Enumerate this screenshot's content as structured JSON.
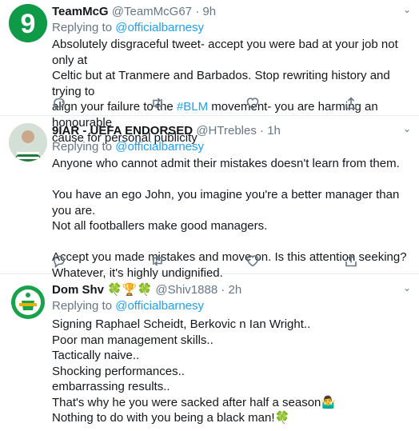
{
  "tweets": [
    {
      "name": "TeamMcG",
      "handle": "@TeamMcG67",
      "dot": "·",
      "time": "9h",
      "reply_prefix": "Replying to",
      "reply_to": "@officialbarnesy",
      "body_lines": [
        "Absolutely disgraceful tweet- accept you were bad at your job not only at",
        "Celtic but at Tranmere and Barbados. Stop rewriting history and trying to"
      ],
      "body_line3_pre": "align your failure to the",
      "hashtag": "#BLM",
      "body_line3_post": "movement- you are harming an honourable",
      "body_line4": "cause for personal publicity",
      "avatar_text": "9"
    },
    {
      "name": "9IAR - UEFA ENDORSED",
      "handle": "@HTrebles",
      "dot": "·",
      "time": "1h",
      "reply_prefix": "Replying to",
      "reply_to": "@officialbarnesy",
      "para1": "Anyone who cannot admit their mistakes doesn't learn from them.",
      "para2a": "You have an ego John, you imagine you're a better manager than you are.",
      "para2b": "Not all footballers make good managers.",
      "para3a": "Accept you made mistakes and move on. Is this attention seeking?",
      "para3b": "Whatever, it's highly undignified."
    },
    {
      "name": "Dom Shv",
      "name_emoji": "🍀🏆🍀",
      "handle": "@Shiv1888",
      "dot": "·",
      "time": "2h",
      "reply_prefix": "Replying to",
      "reply_to": "@officialbarnesy",
      "lines": [
        "Signing Raphael Scheidt, Berkovic n Ian Wright..",
        "Poor man management skills..",
        "Tactically naive..",
        "Shocking performances..",
        "embarrassing results.."
      ],
      "line6": "That's why he you were sacked after half a season",
      "line6_emoji": "🤷‍♂️",
      "line7": "Nothing to do with you being a black man!",
      "line7_emoji": "🍀"
    }
  ],
  "icons": [
    "reply-icon",
    "retweet-icon",
    "like-icon",
    "share-icon",
    "chevron-down-icon"
  ],
  "colors": {
    "link": "#1da1f2",
    "muted": "#657786",
    "text": "#14171a",
    "border": "#e6ecf0"
  }
}
